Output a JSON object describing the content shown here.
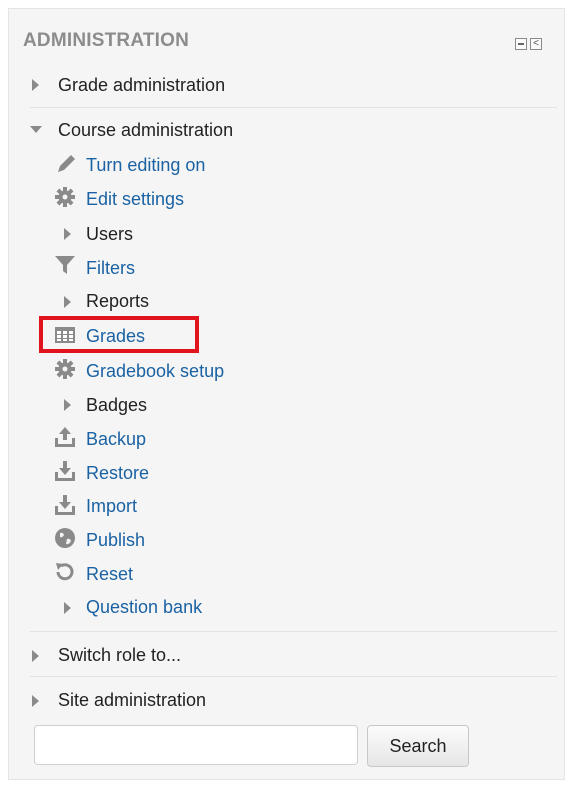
{
  "block": {
    "title": "ADMINISTRATION",
    "controls": {
      "minimize_icon": "minus-box-icon",
      "dock_icon": "dock-left-icon",
      "dock_glyph": "<"
    }
  },
  "nav": {
    "grade_administration": "Grade administration",
    "course_administration": "Course administration",
    "course_items": {
      "turn_editing_on": "Turn editing on",
      "edit_settings": "Edit settings",
      "users": "Users",
      "filters": "Filters",
      "reports": "Reports",
      "grades": "Grades",
      "gradebook_setup": "Gradebook setup",
      "badges": "Badges",
      "backup": "Backup",
      "restore": "Restore",
      "import": "Import",
      "publish": "Publish",
      "reset": "Reset",
      "question_bank": "Question bank"
    },
    "switch_role": "Switch role to...",
    "site_administration": "Site administration"
  },
  "search": {
    "value": "",
    "placeholder": "",
    "button_label": "Search"
  },
  "colors": {
    "link": "#1a62a3",
    "text": "#222222",
    "title": "#8c8c8c",
    "highlight": "#e0141c",
    "icon": "#8a8a8a"
  }
}
